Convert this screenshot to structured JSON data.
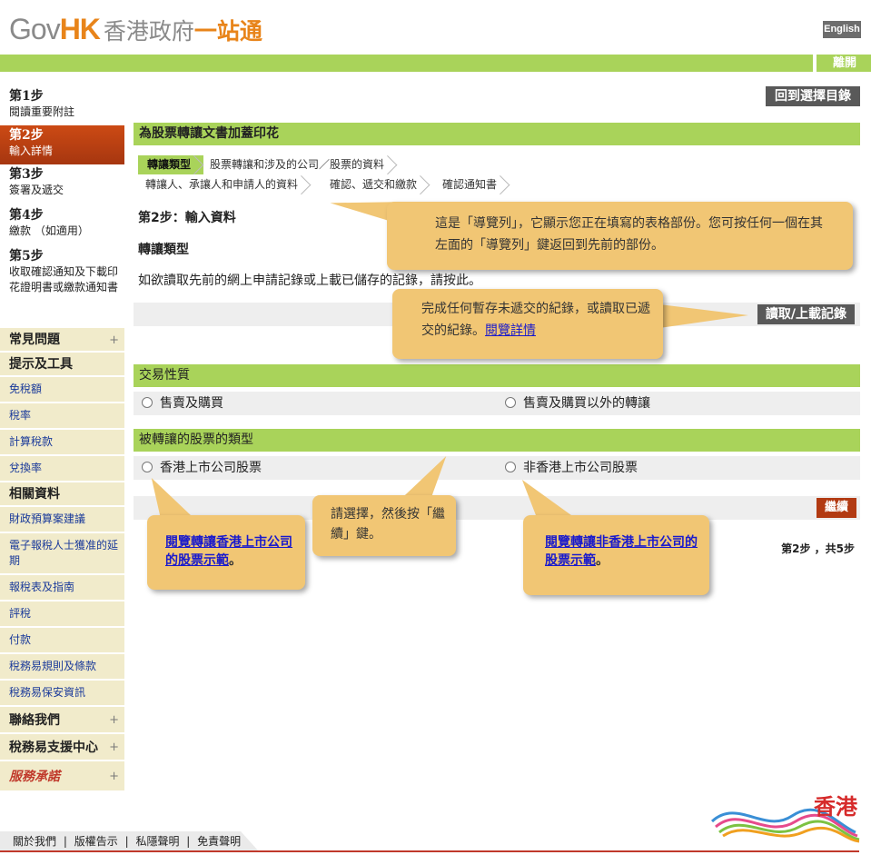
{
  "header": {
    "logo_gov": "Gov",
    "logo_hk": "HK",
    "logo_zh1": "香港政府",
    "logo_zh2": "一站通",
    "lang_button": "English",
    "exit_link": "離開"
  },
  "sidebar": {
    "steps": [
      {
        "title": "第1步",
        "desc": "閱讀重要附註"
      },
      {
        "title": "第2步",
        "desc": "輸入詳情"
      },
      {
        "title": "第3步",
        "desc": "簽署及遞交"
      },
      {
        "title": "第4步",
        "desc": "繳款 （如適用）"
      },
      {
        "title": "第5步",
        "desc": "收取確認通知及下載印花證明書或繳款通知書"
      }
    ],
    "faq": "常見問題",
    "tools": "提示及工具",
    "tool_links": [
      "免稅額",
      "稅率",
      "計算稅款",
      "兌換率"
    ],
    "related": "相關資料",
    "related_links": [
      "財政預算案建議",
      "電子報稅人士獲准的延期",
      "報稅表及指南",
      "評稅",
      "付款",
      "稅務易規則及條款",
      "稅務易保安資訊"
    ],
    "contact": "聯絡我們",
    "support": "稅務易支援中心",
    "pledge": "服務承諾",
    "plus": "+"
  },
  "main": {
    "back_button": "回到選擇目錄",
    "form_title": "為股票轉讓文書加蓋印花",
    "breadcrumbs": [
      "轉讓類型",
      "股票轉讓和涉及的公司／股票的資料",
      "轉讓人、承讓人和申請人的資料",
      "確認、遞交和繳款",
      "確認通知書"
    ],
    "step_heading": "第2步：輸入資料",
    "section_heading": "轉讓類型",
    "retrieve_text": "如欲讀取先前的網上申請記錄或上載已儲存的記錄，請按此。",
    "load_button": "讀取/上載記錄",
    "nature_heading": "交易性質",
    "nature_options": [
      "售賣及購買",
      "售賣及購買以外的轉讓"
    ],
    "type_heading": "被轉讓的股票的類型",
    "type_options": [
      "香港上市公司股票",
      "非香港上市公司股票"
    ],
    "continue_button": "繼續",
    "step_count": "第2步 ，共5步"
  },
  "callouts": {
    "nav_hint": "這是「導覽列」，它顯示您正在填寫的表格部份。您可按任何一個在其左面的「導覽列」鍵返回到先前的部份。",
    "load_hint_text": "完成任何暫存未遞交的紀錄，或讀取已遞交的紀錄。",
    "load_hint_link": "閱覽詳情",
    "choose_hint": "請選擇，然後按「繼續」鍵。",
    "hk_link": "閱覽轉讓香港上市公司的股票示範",
    "nonhk_link": "閱覽轉讓非香港上市公司的股票示範",
    "period": "。"
  },
  "footer": {
    "links": [
      "關於我們",
      "版權告示",
      "私隱聲明",
      "免責聲明"
    ],
    "separator": "|",
    "brand_text": "香港"
  },
  "colors": {
    "green_bar": "#a9d35a",
    "active_step": "#b23a12",
    "callout": "#f1c674",
    "button_dark": "#595959",
    "brand_red": "#c0392b"
  }
}
